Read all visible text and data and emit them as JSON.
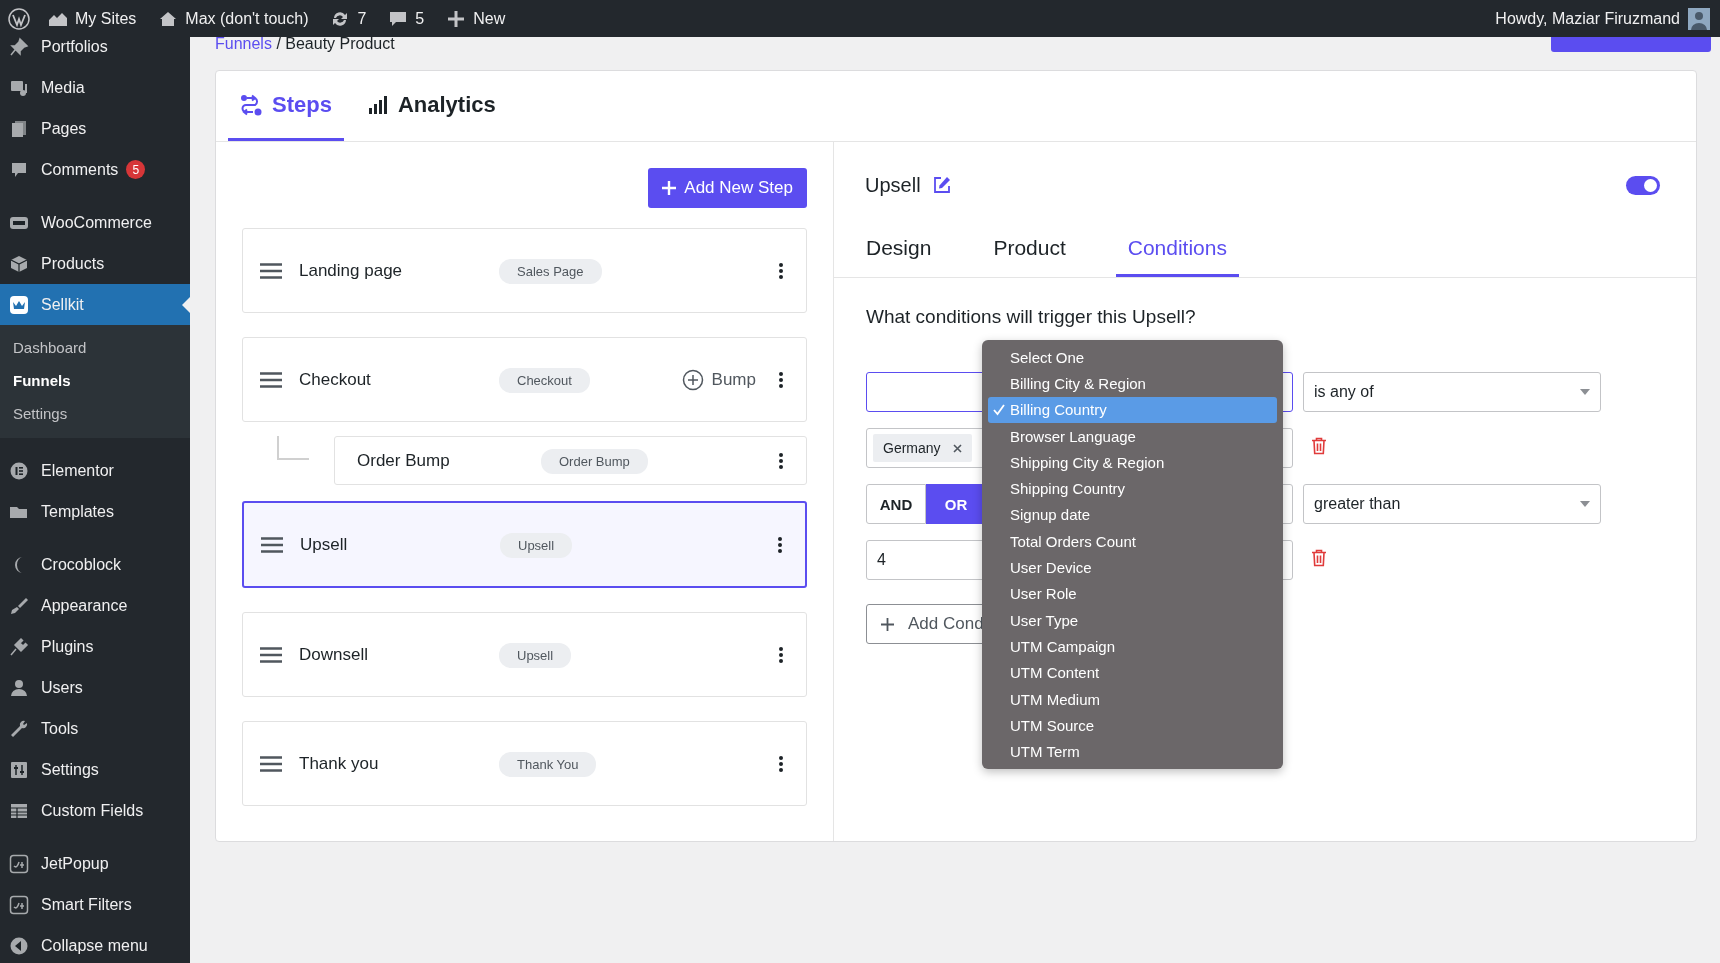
{
  "admin_bar": {
    "items": [
      {
        "label": "My Sites"
      },
      {
        "label": "Max (don't touch)"
      },
      {
        "label": "7"
      },
      {
        "label": "5"
      },
      {
        "label": "New"
      }
    ],
    "greeting": "Howdy, Maziar Firuzmand"
  },
  "sidebar": {
    "groups": [
      [
        {
          "label": "Portfolios",
          "selected": false
        },
        {
          "label": "Media",
          "selected": false
        },
        {
          "label": "Pages",
          "selected": false
        },
        {
          "label": "Comments",
          "badge": "5",
          "selected": false
        }
      ],
      [
        {
          "label": "WooCommerce",
          "selected": false
        },
        {
          "label": "Products",
          "selected": false
        },
        {
          "label": "Sellkit",
          "selected": true,
          "children": [
            {
              "label": "Dashboard",
              "selected": false
            },
            {
              "label": "Funnels",
              "selected": true
            },
            {
              "label": "Settings",
              "selected": false
            }
          ]
        }
      ],
      [
        {
          "label": "Elementor",
          "selected": false
        },
        {
          "label": "Templates",
          "selected": false
        }
      ],
      [
        {
          "label": "Crocoblock",
          "selected": false
        },
        {
          "label": "Appearance",
          "selected": false
        },
        {
          "label": "Plugins",
          "selected": false
        },
        {
          "label": "Users",
          "selected": false
        },
        {
          "label": "Tools",
          "selected": false
        },
        {
          "label": "Settings",
          "selected": false
        },
        {
          "label": "Custom Fields",
          "selected": false
        }
      ],
      [
        {
          "label": "JetPopup",
          "selected": false
        },
        {
          "label": "Smart Filters",
          "selected": false
        },
        {
          "label": "Collapse menu",
          "selected": false
        }
      ]
    ]
  },
  "breadcrumb": {
    "link": "Funnels",
    "separator": "/",
    "current": "Beauty Product"
  },
  "tabs": [
    {
      "label": "Steps",
      "selected": true
    },
    {
      "label": "Analytics",
      "selected": false
    }
  ],
  "steps": {
    "add_button": "Add New Step",
    "items": [
      {
        "name": "Landing page",
        "tag": "Sales Page",
        "selected": false
      },
      {
        "name": "Checkout",
        "tag": "Checkout",
        "action": "Bump",
        "selected": false,
        "children": [
          {
            "name": "Order Bump",
            "tag": "Order Bump",
            "selected": false
          }
        ]
      },
      {
        "name": "Upsell",
        "tag": "Upsell",
        "selected": true
      },
      {
        "name": "Downsell",
        "tag": "Upsell",
        "selected": false
      },
      {
        "name": "Thank you",
        "tag": "Thank You",
        "selected": false
      }
    ]
  },
  "detail": {
    "title": "Upsell",
    "enabled": true,
    "tabs": [
      {
        "label": "Design",
        "selected": false
      },
      {
        "label": "Product",
        "selected": false
      },
      {
        "label": "Conditions",
        "selected": true
      }
    ],
    "question": "What conditions will trigger this Upsell?",
    "rows": [
      {
        "kind": "select",
        "operator": "is any of"
      },
      {
        "kind": "tags",
        "tags": [
          "Germany"
        ]
      },
      {
        "kind": "logic",
        "options": [
          {
            "label": "AND",
            "selected": false
          },
          {
            "label": "OR",
            "selected": true
          }
        ],
        "operator": "greater than"
      },
      {
        "kind": "input",
        "value": "4"
      }
    ],
    "add_button": "Add Cond",
    "dropdown": {
      "options": [
        {
          "label": "Select One",
          "selected": false
        },
        {
          "label": "Billing City & Region",
          "selected": false
        },
        {
          "label": "Billing Country",
          "selected": true
        },
        {
          "label": "Browser Language",
          "selected": false
        },
        {
          "label": "Shipping City & Region",
          "selected": false
        },
        {
          "label": "Shipping Country",
          "selected": false
        },
        {
          "label": "Signup date",
          "selected": false
        },
        {
          "label": "Total Orders Count",
          "selected": false
        },
        {
          "label": "User Device",
          "selected": false
        },
        {
          "label": "User Role",
          "selected": false
        },
        {
          "label": "User Type",
          "selected": false
        },
        {
          "label": "UTM Campaign",
          "selected": false
        },
        {
          "label": "UTM Content",
          "selected": false
        },
        {
          "label": "UTM Medium",
          "selected": false
        },
        {
          "label": "UTM Source",
          "selected": false
        },
        {
          "label": "UTM Term",
          "selected": false
        }
      ]
    }
  }
}
